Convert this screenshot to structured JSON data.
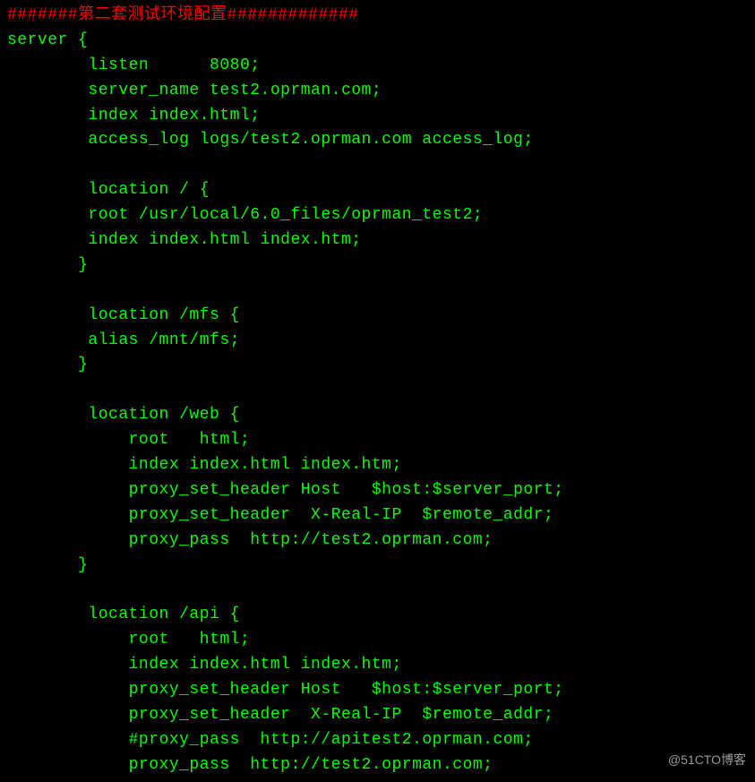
{
  "lines": [
    {
      "cls": "comment",
      "text": "#######第二套测试环境配置#############"
    },
    {
      "cls": "",
      "text": "server {"
    },
    {
      "cls": "",
      "text": "        listen      8080;"
    },
    {
      "cls": "",
      "text": "        server_name test2.oprman.com;"
    },
    {
      "cls": "",
      "text": "        index index.html;"
    },
    {
      "cls": "",
      "text": "        access_log logs/test2.oprman.com access_log;"
    },
    {
      "cls": "",
      "text": ""
    },
    {
      "cls": "",
      "text": "        location / {"
    },
    {
      "cls": "",
      "text": "        root /usr/local/6.0_files/oprman_test2;"
    },
    {
      "cls": "",
      "text": "        index index.html index.htm;"
    },
    {
      "cls": "",
      "text": "       }"
    },
    {
      "cls": "",
      "text": ""
    },
    {
      "cls": "",
      "text": "        location /mfs {"
    },
    {
      "cls": "",
      "text": "        alias /mnt/mfs;"
    },
    {
      "cls": "",
      "text": "       }"
    },
    {
      "cls": "",
      "text": ""
    },
    {
      "cls": "",
      "text": "        location /web {"
    },
    {
      "cls": "",
      "text": "            root   html;"
    },
    {
      "cls": "",
      "text": "            index index.html index.htm;"
    },
    {
      "cls": "",
      "text": "            proxy_set_header Host   $host:$server_port;"
    },
    {
      "cls": "",
      "text": "            proxy_set_header  X-Real-IP  $remote_addr;"
    },
    {
      "cls": "",
      "text": "            proxy_pass  http://test2.oprman.com;"
    },
    {
      "cls": "",
      "text": "       }"
    },
    {
      "cls": "",
      "text": ""
    },
    {
      "cls": "",
      "text": "        location /api {"
    },
    {
      "cls": "",
      "text": "            root   html;"
    },
    {
      "cls": "",
      "text": "            index index.html index.htm;"
    },
    {
      "cls": "",
      "text": "            proxy_set_header Host   $host:$server_port;"
    },
    {
      "cls": "",
      "text": "            proxy_set_header  X-Real-IP  $remote_addr;"
    },
    {
      "cls": "",
      "text": "            #proxy_pass  http://apitest2.oprman.com;"
    },
    {
      "cls": "",
      "text": "            proxy_pass  http://test2.oprman.com;"
    }
  ],
  "watermark": "@51CTO博客"
}
